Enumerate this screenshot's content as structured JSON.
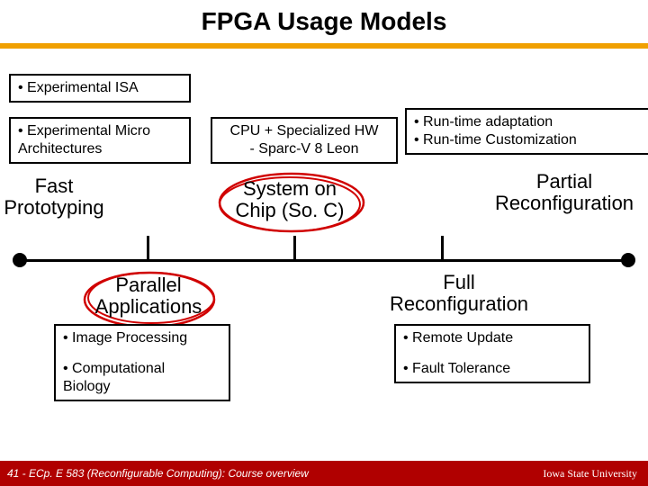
{
  "title": "FPGA Usage Models",
  "boxes": {
    "exp_isa": "• Experimental ISA",
    "exp_micro_l1": "• Experimental Micro",
    "exp_micro_l2": "  Architectures",
    "cpu_hw_l1": "CPU + Specialized HW",
    "cpu_hw_l2": "- Sparc-V 8 Leon",
    "runtime_l1": "• Run-time adaptation",
    "runtime_l2": "• Run-time Customization",
    "bl_l1": "• Image Processing",
    "bl_l2": "• Computational",
    "bl_l3": "  Biology",
    "br_l1": "• Remote Update",
    "br_l2": "• Fault Tolerance"
  },
  "labels": {
    "fast_l1": "Fast",
    "fast_l2": "Prototyping",
    "soc_l1": "System on",
    "soc_l2": "Chip (So. C)",
    "partial_l1": "Partial",
    "partial_l2": "Reconfiguration",
    "parallel_l1": "Parallel",
    "parallel_l2": "Applications",
    "full_l1": "Full",
    "full_l2": "Reconfiguration"
  },
  "footer": {
    "left": "41 - ECp. E 583 (Reconfigurable Computing): Course overview",
    "right": "Iowa State University"
  }
}
